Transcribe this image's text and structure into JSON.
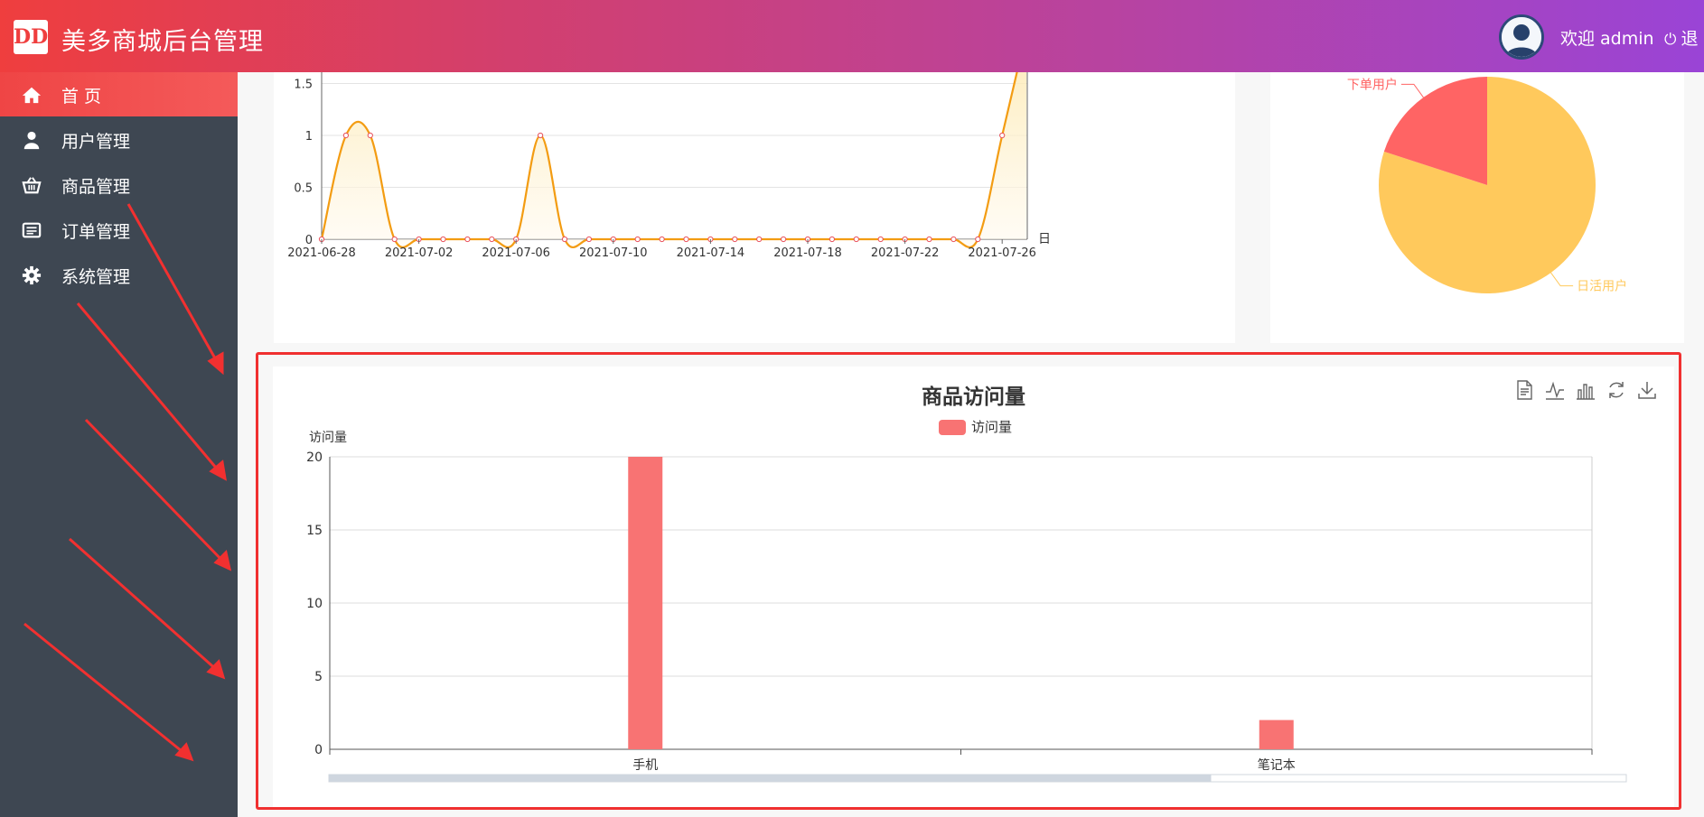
{
  "header": {
    "logo_text": "DD",
    "title": "美多商城后台管理",
    "welcome": "欢迎 admin",
    "logout": "退"
  },
  "sidebar": {
    "items": [
      {
        "label": "首 页",
        "icon": "home-icon",
        "active": true
      },
      {
        "label": "用户管理",
        "icon": "user-icon",
        "active": false
      },
      {
        "label": "商品管理",
        "icon": "basket-icon",
        "active": false
      },
      {
        "label": "订单管理",
        "icon": "list-icon",
        "active": false
      },
      {
        "label": "系统管理",
        "icon": "gear-icon",
        "active": false
      }
    ]
  },
  "colors": {
    "accent_red": "#ef4545",
    "sidebar_bg": "#3e4752",
    "line_color": "#f39c12",
    "bar_color": "#f87373",
    "pie_active": "#ffc95c",
    "pie_order": "#ff6464",
    "highlight_border": "#f03030"
  },
  "chart_data": [
    {
      "type": "area",
      "xlabel": "日",
      "ylim": [
        0,
        2
      ],
      "y_ticks": [
        "0",
        "0.5",
        "1",
        "1.5"
      ],
      "x_tick_labels": [
        "2021-06-28",
        "2021-07-02",
        "2021-07-06",
        "2021-07-10",
        "2021-07-14",
        "2021-07-18",
        "2021-07-22",
        "2021-07-26"
      ],
      "x": [
        "2021-06-28",
        "2021-06-29",
        "2021-06-30",
        "2021-07-01",
        "2021-07-02",
        "2021-07-03",
        "2021-07-04",
        "2021-07-05",
        "2021-07-06",
        "2021-07-07",
        "2021-07-08",
        "2021-07-09",
        "2021-07-10",
        "2021-07-11",
        "2021-07-12",
        "2021-07-13",
        "2021-07-14",
        "2021-07-15",
        "2021-07-16",
        "2021-07-17",
        "2021-07-18",
        "2021-07-19",
        "2021-07-20",
        "2021-07-21",
        "2021-07-22",
        "2021-07-23",
        "2021-07-24",
        "2021-07-25",
        "2021-07-26",
        "2021-07-27"
      ],
      "values": [
        0,
        1,
        1,
        0,
        0,
        0,
        0,
        0,
        0,
        1,
        0,
        0,
        0,
        0,
        0,
        0,
        0,
        0,
        0,
        0,
        0,
        0,
        0,
        0,
        0,
        0,
        0,
        0,
        1,
        2
      ]
    },
    {
      "type": "pie",
      "slices": [
        {
          "name": "日活用户",
          "value": 80
        },
        {
          "name": "下单用户",
          "value": 20
        }
      ]
    },
    {
      "type": "bar",
      "title": "商品访问量",
      "ylabel": "访问量",
      "categories": [
        "手机",
        "笔记本"
      ],
      "series": [
        {
          "name": "访问量",
          "values": [
            20,
            2
          ]
        }
      ],
      "ylim": [
        0,
        20
      ],
      "y_ticks": [
        "0",
        "5",
        "10",
        "15",
        "20"
      ],
      "legend": "top",
      "dataZoom_visible_fraction": 0.68
    }
  ]
}
